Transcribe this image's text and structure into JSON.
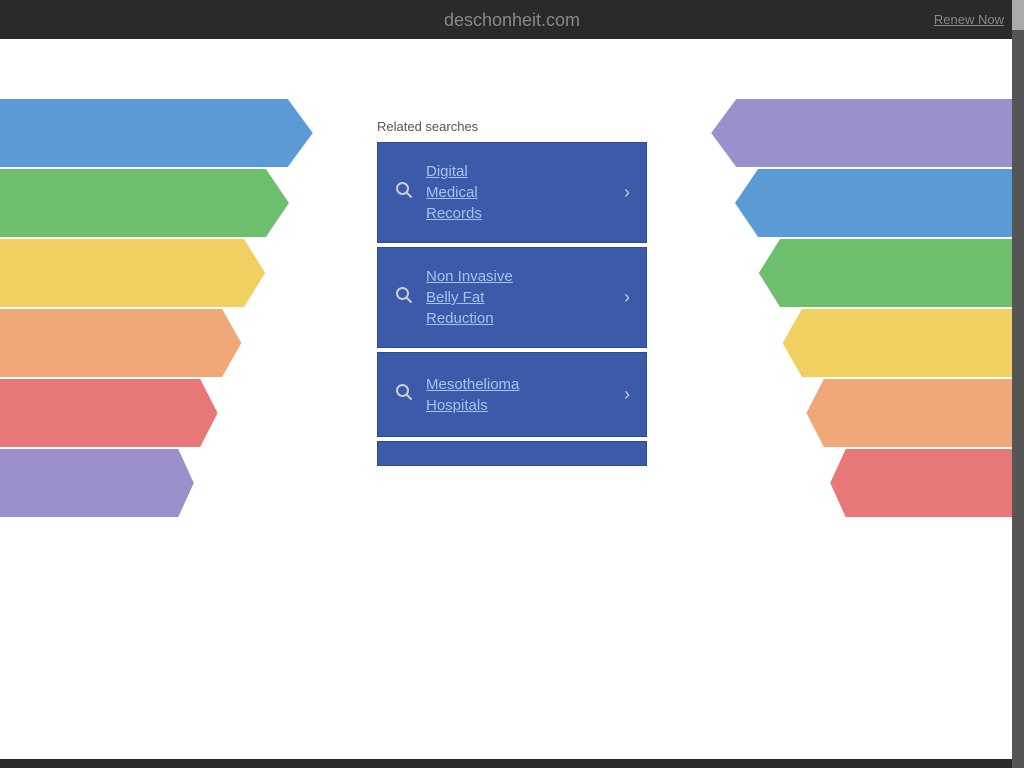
{
  "header": {
    "site_title": "deschonheit.com",
    "renew_now_label": "Renew Now"
  },
  "related_searches": {
    "label": "Related searches",
    "cards": [
      {
        "id": "card-1",
        "line1": "Digital",
        "line2": "Medical",
        "line3": "Records",
        "text": "Digital Medical Records"
      },
      {
        "id": "card-2",
        "line1": "Non Invasive",
        "line2": "Belly Fat",
        "line3": "Reduction",
        "text": "Non Invasive Belly Fat Reduction"
      },
      {
        "id": "card-3",
        "line1": "Mesothelioma",
        "line2": "Hospitals",
        "line3": "",
        "text": "Mesothelioma Hospitals"
      }
    ]
  },
  "ribbons": {
    "colors": [
      "#5b9bd5",
      "#6dbf6d",
      "#f0d060",
      "#f0a070",
      "#e87878",
      "#9b8fcc"
    ],
    "right_colors": [
      "#9b8fcc",
      "#5b9bd5",
      "#6dbf6d",
      "#f0d060",
      "#f0a070",
      "#e87878"
    ]
  },
  "colors": {
    "card_bg": "#3b5baa",
    "card_text": "#a8c0f0",
    "top_bar_bg": "#2a2a2a",
    "main_bg": "#ffffff"
  }
}
